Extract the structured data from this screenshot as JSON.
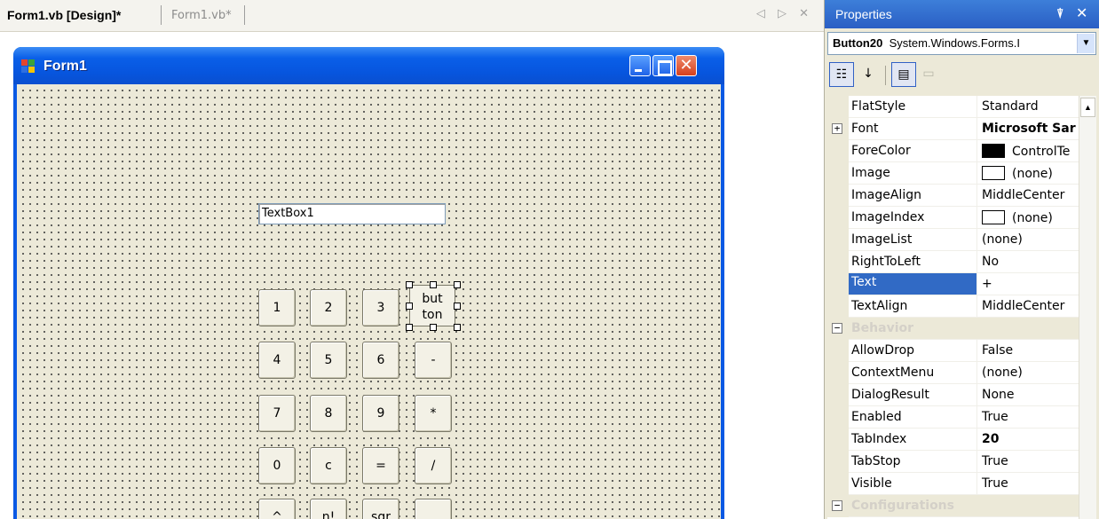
{
  "tabs": {
    "design": "Form1.vb [Design]*",
    "code": "Form1.vb*",
    "nav": "◁ ▷ ✕"
  },
  "form": {
    "title": "Form1",
    "textbox": "TextBox1",
    "buttons": [
      "1",
      "2",
      "3",
      "4",
      "5",
      "6",
      "-",
      "7",
      "8",
      "9",
      "*",
      "0",
      "c",
      "=",
      "/",
      "^",
      "n!",
      "sqr",
      "."
    ],
    "selected_button": "but ton"
  },
  "properties": {
    "title": "Properties",
    "pin": "ᵖ",
    "close": "✕",
    "object_name": "Button20",
    "object_type": "System.Windows.Forms.I",
    "toolbar": {
      "categorized_icon": "categorized-icon",
      "alphabetical_icon": "alphabetical-icon",
      "properties_icon": "properties-icon",
      "events_icon": "events-icon"
    },
    "rows": [
      {
        "name": "FlatStyle",
        "value": "Standard"
      },
      {
        "name": "Font",
        "value": "Microsoft Sar",
        "expandable": true
      },
      {
        "name": "ForeColor",
        "value": "ControlTe",
        "swatch": "#000000"
      },
      {
        "name": "Image",
        "value": "(none)",
        "swatch": "#ffffff"
      },
      {
        "name": "ImageAlign",
        "value": "MiddleCenter"
      },
      {
        "name": "ImageIndex",
        "value": "(none)",
        "swatch": "#ffffff"
      },
      {
        "name": "ImageList",
        "value": "(none)"
      },
      {
        "name": "RightToLeft",
        "value": "No"
      },
      {
        "name": "Text",
        "value": "+",
        "selected": true
      },
      {
        "name": "TextAlign",
        "value": "MiddleCenter"
      },
      {
        "name": "Behavior",
        "value": "",
        "category": true
      },
      {
        "name": "AllowDrop",
        "value": "False"
      },
      {
        "name": "ContextMenu",
        "value": "(none)"
      },
      {
        "name": "DialogResult",
        "value": "None"
      },
      {
        "name": "Enabled",
        "value": "True"
      },
      {
        "name": "TabIndex",
        "value": "20",
        "bold": true
      },
      {
        "name": "TabStop",
        "value": "True"
      },
      {
        "name": "Visible",
        "value": "True"
      },
      {
        "name": "Configurations",
        "value": "",
        "category": true
      }
    ]
  },
  "colors": {
    "titlebar": "#0a5fe8",
    "selection": "#316ac5",
    "form_bg": "#ece9d8"
  }
}
